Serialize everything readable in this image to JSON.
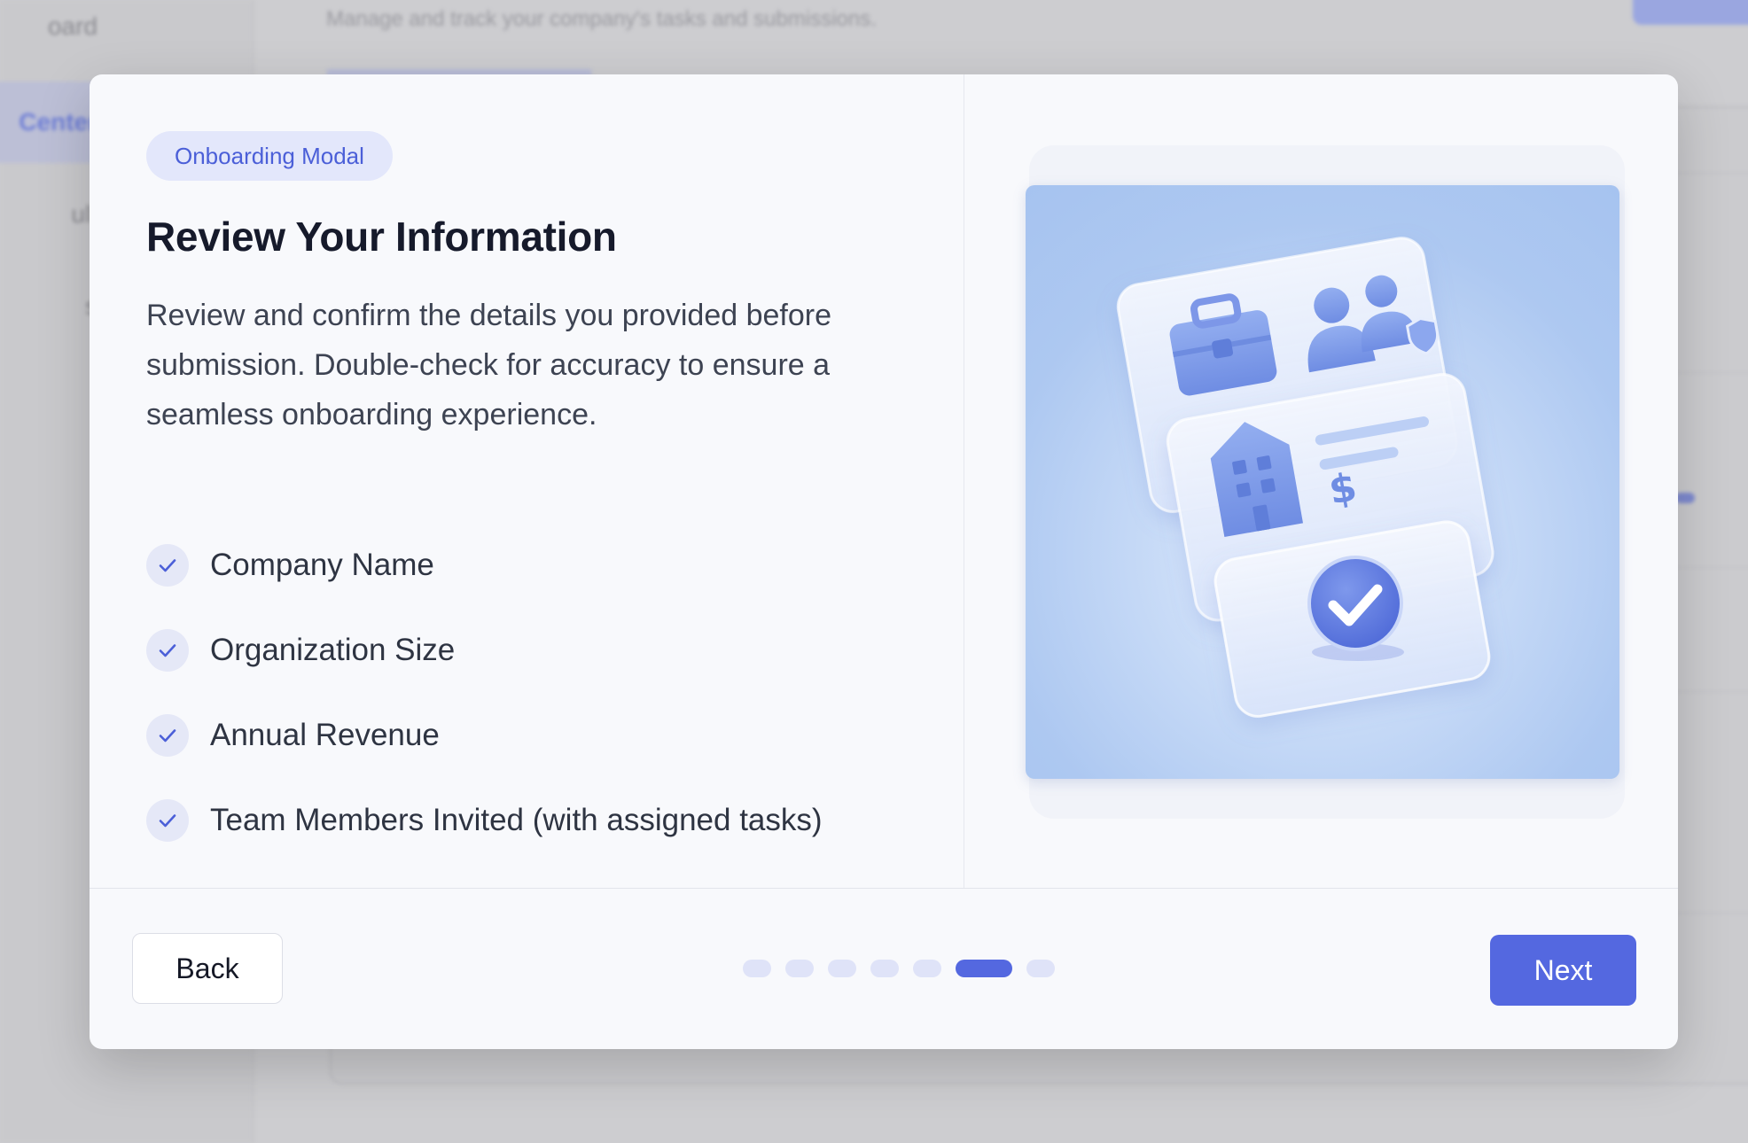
{
  "background": {
    "nav_items": [
      "oard",
      "Center",
      "ult",
      "s"
    ],
    "active_nav_index": 1,
    "subtitle": "Manage and track your company's tasks and submissions."
  },
  "modal": {
    "badge": "Onboarding Modal",
    "title": "Review Your Information",
    "description": "Review and confirm the details you provided before submission. Double-check for accuracy to ensure a seamless onboarding experience.",
    "checklist": [
      {
        "label": "Company Name",
        "icon": "check-icon"
      },
      {
        "label": "Organization Size",
        "icon": "check-icon"
      },
      {
        "label": "Annual Revenue",
        "icon": "check-icon"
      },
      {
        "label": "Team Members Invited (with assigned tasks)",
        "icon": "check-icon"
      }
    ],
    "illustration": {
      "icons": [
        "briefcase-icon",
        "team-icon",
        "building-icon",
        "dollar-icon",
        "check-badge-icon"
      ]
    },
    "footer": {
      "back_label": "Back",
      "next_label": "Next",
      "steps_total": 7,
      "current_step": 6
    }
  },
  "colors": {
    "accent": "#5468e0",
    "badge_bg": "#e3e7fb",
    "check_bg": "#e5e8f7",
    "illustration_bg": "#adc8f1"
  }
}
